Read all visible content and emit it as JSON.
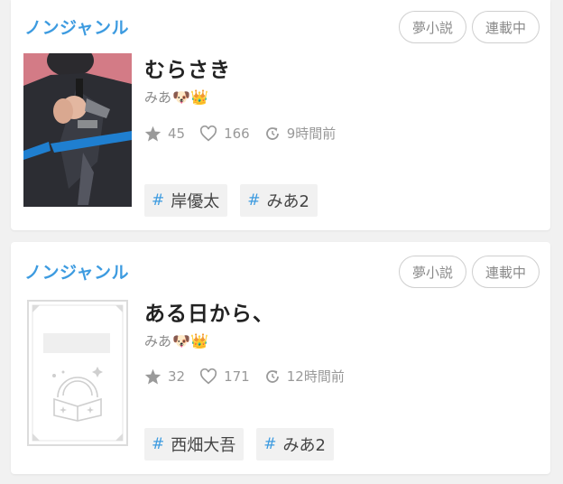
{
  "cards": [
    {
      "genre": "ノンジャンル",
      "badges": [
        "夢小説",
        "連載中"
      ],
      "title": "むらさき",
      "author": "みあ",
      "author_emojis": "🐶👑",
      "stats": {
        "stars": "45",
        "likes": "166",
        "updated": "9時間前"
      },
      "tags": [
        {
          "hash": "#",
          "label": "岸優太"
        },
        {
          "hash": "#",
          "label": "みあ2"
        }
      ]
    },
    {
      "genre": "ノンジャンル",
      "badges": [
        "夢小説",
        "連載中"
      ],
      "title": "ある日から、",
      "author": "みあ",
      "author_emojis": "🐶👑",
      "stats": {
        "stars": "32",
        "likes": "171",
        "updated": "12時間前"
      },
      "tags": [
        {
          "hash": "#",
          "label": "西畑大吾"
        },
        {
          "hash": "#",
          "label": "みあ2"
        }
      ]
    }
  ],
  "colors": {
    "genre": "#3d9be0",
    "hash": "#3d9be0",
    "badge_border": "#cfcfcf",
    "background": "#f1f1f1"
  },
  "icons": {
    "star": "star-icon",
    "heart": "heart-icon",
    "updated": "clock-refresh-icon"
  }
}
